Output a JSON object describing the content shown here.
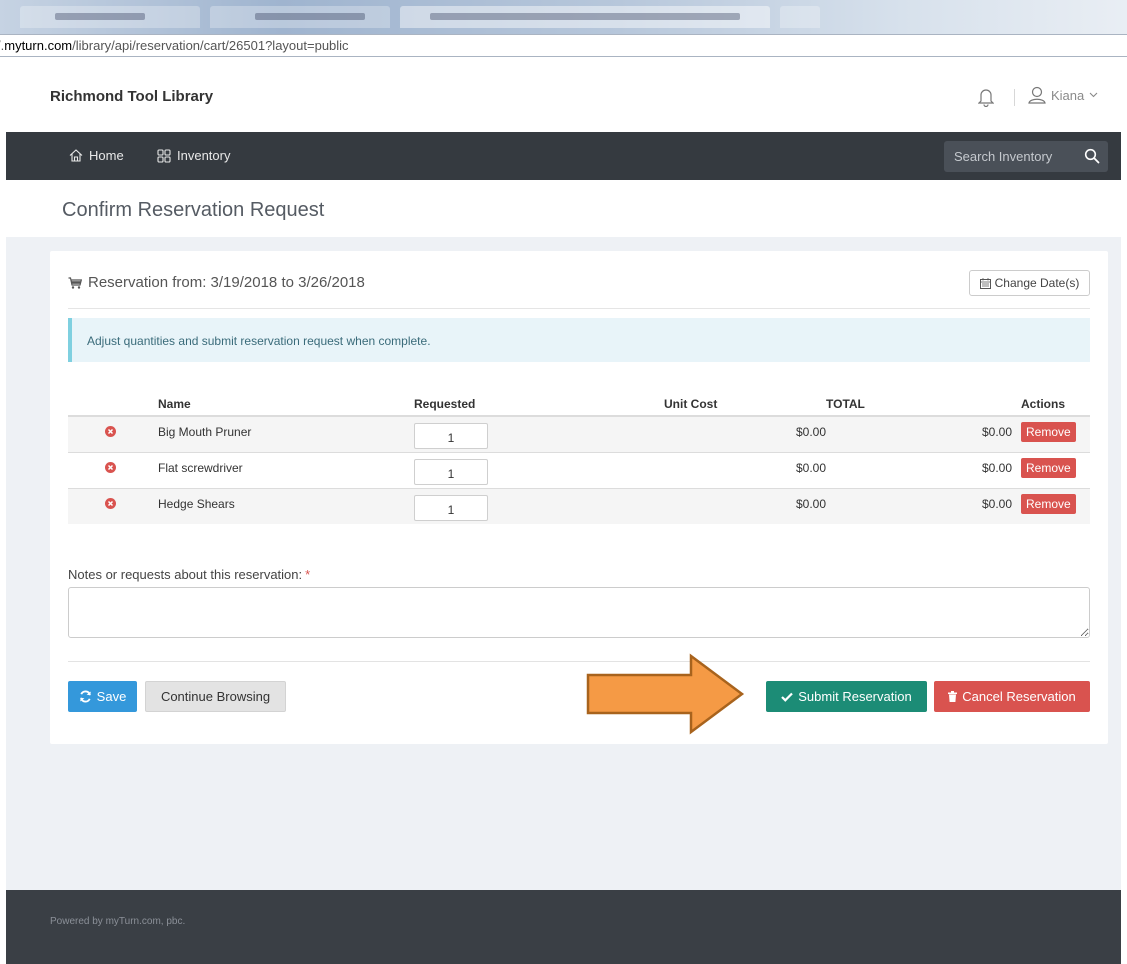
{
  "browser": {
    "url_host": "myturn.com",
    "url_prefix": "/.",
    "url_path": "/library/api/reservation/cart/26501?layout=public"
  },
  "header": {
    "brand": "Richmond Tool Library",
    "user_name": "Kiana"
  },
  "nav": {
    "home_label": "Home",
    "inventory_label": "Inventory",
    "search_placeholder": "Search Inventory"
  },
  "page": {
    "title": "Confirm Reservation Request"
  },
  "reservation": {
    "heading": "Reservation from: 3/19/2018 to 3/26/2018",
    "change_dates_label": "Change Date(s)",
    "alert": "Adjust quantities and submit reservation request when complete."
  },
  "table": {
    "headers": {
      "name": "Name",
      "requested": "Requested",
      "unit_cost": "Unit Cost",
      "total": "TOTAL",
      "actions": "Actions"
    },
    "rows": [
      {
        "name": "Big Mouth Pruner",
        "requested": "1",
        "unit_cost": "$0.00",
        "total": "$0.00",
        "action": "Remove"
      },
      {
        "name": "Flat screwdriver",
        "requested": "1",
        "unit_cost": "$0.00",
        "total": "$0.00",
        "action": "Remove"
      },
      {
        "name": "Hedge Shears",
        "requested": "1",
        "unit_cost": "$0.00",
        "total": "$0.00",
        "action": "Remove"
      }
    ]
  },
  "notes": {
    "label": "Notes or requests about this reservation:",
    "required_mark": "*",
    "value": ""
  },
  "buttons": {
    "save": "Save",
    "continue": "Continue Browsing",
    "submit": "Submit Reservation",
    "cancel": "Cancel Reservation"
  },
  "footer": {
    "text": "Powered by myTurn.com, pbc."
  },
  "colors": {
    "navbar": "#353a40",
    "primary": "#3498db",
    "success": "#1c8c76",
    "danger": "#d9534f",
    "arrow_fill": "#f59a45",
    "arrow_stroke": "#a8631d"
  },
  "icons": [
    "home-icon",
    "grid-icon",
    "search-icon",
    "bell-icon",
    "user-icon",
    "chevron-down-icon",
    "cart-icon",
    "calendar-icon",
    "remove-circle-icon",
    "refresh-icon",
    "check-icon",
    "trash-icon",
    "arrow-right-icon"
  ]
}
